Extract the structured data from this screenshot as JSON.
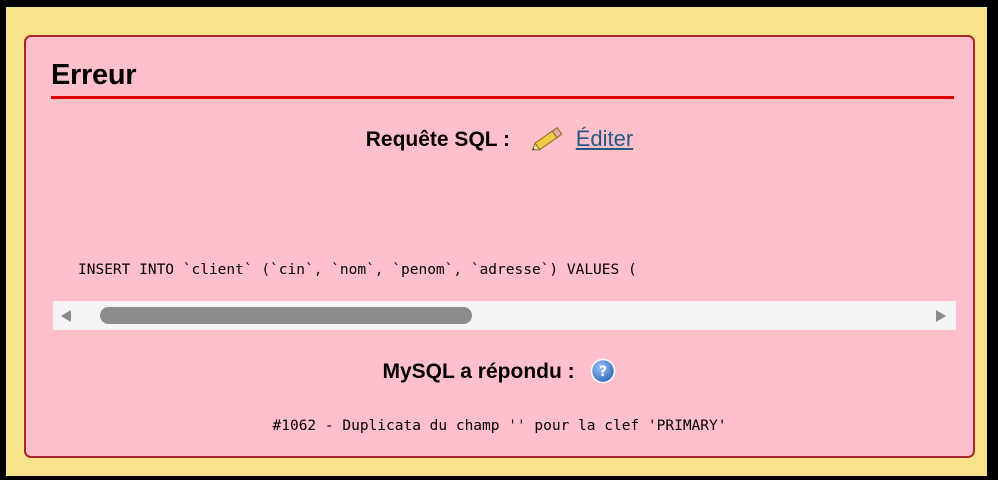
{
  "error_panel": {
    "title": "Erreur",
    "sql_label": "Requête SQL :",
    "edit_link": "Éditer",
    "sql_query": "INSERT INTO `client` (`cin`, `nom`, `penom`, `adresse`) VALUES (",
    "mysql_label": "MySQL a répondu :",
    "mysql_message": "#1062 - Duplicata du champ '' pour la clef 'PRIMARY'"
  },
  "icons": {
    "edit": "pencil-icon",
    "help": "help-icon"
  },
  "colors": {
    "outer_background": "#f9e38a",
    "error_background": "#ffc0cb",
    "error_border": "#a8262b",
    "title_rule": "#e00000",
    "link": "#235a81"
  }
}
